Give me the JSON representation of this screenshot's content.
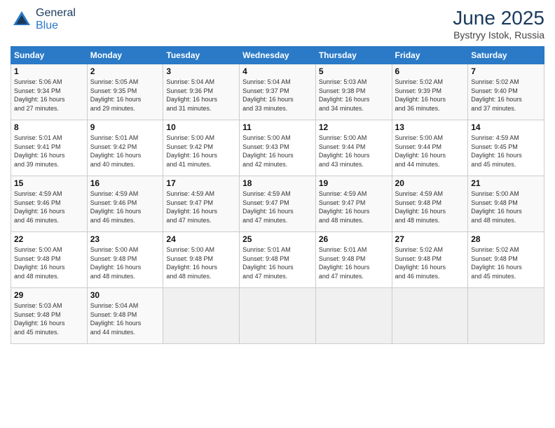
{
  "header": {
    "logo_general": "General",
    "logo_blue": "Blue",
    "title": "June 2025",
    "subtitle": "Bystryy Istok, Russia"
  },
  "days_of_week": [
    "Sunday",
    "Monday",
    "Tuesday",
    "Wednesday",
    "Thursday",
    "Friday",
    "Saturday"
  ],
  "weeks": [
    [
      {
        "day": "1",
        "sunrise": "5:06 AM",
        "sunset": "9:34 PM",
        "daylight": "16 hours and 27 minutes."
      },
      {
        "day": "2",
        "sunrise": "5:05 AM",
        "sunset": "9:35 PM",
        "daylight": "16 hours and 29 minutes."
      },
      {
        "day": "3",
        "sunrise": "5:04 AM",
        "sunset": "9:36 PM",
        "daylight": "16 hours and 31 minutes."
      },
      {
        "day": "4",
        "sunrise": "5:04 AM",
        "sunset": "9:37 PM",
        "daylight": "16 hours and 33 minutes."
      },
      {
        "day": "5",
        "sunrise": "5:03 AM",
        "sunset": "9:38 PM",
        "daylight": "16 hours and 34 minutes."
      },
      {
        "day": "6",
        "sunrise": "5:02 AM",
        "sunset": "9:39 PM",
        "daylight": "16 hours and 36 minutes."
      },
      {
        "day": "7",
        "sunrise": "5:02 AM",
        "sunset": "9:40 PM",
        "daylight": "16 hours and 37 minutes."
      }
    ],
    [
      {
        "day": "8",
        "sunrise": "5:01 AM",
        "sunset": "9:41 PM",
        "daylight": "16 hours and 39 minutes."
      },
      {
        "day": "9",
        "sunrise": "5:01 AM",
        "sunset": "9:42 PM",
        "daylight": "16 hours and 40 minutes."
      },
      {
        "day": "10",
        "sunrise": "5:00 AM",
        "sunset": "9:42 PM",
        "daylight": "16 hours and 41 minutes."
      },
      {
        "day": "11",
        "sunrise": "5:00 AM",
        "sunset": "9:43 PM",
        "daylight": "16 hours and 42 minutes."
      },
      {
        "day": "12",
        "sunrise": "5:00 AM",
        "sunset": "9:44 PM",
        "daylight": "16 hours and 43 minutes."
      },
      {
        "day": "13",
        "sunrise": "5:00 AM",
        "sunset": "9:44 PM",
        "daylight": "16 hours and 44 minutes."
      },
      {
        "day": "14",
        "sunrise": "4:59 AM",
        "sunset": "9:45 PM",
        "daylight": "16 hours and 45 minutes."
      }
    ],
    [
      {
        "day": "15",
        "sunrise": "4:59 AM",
        "sunset": "9:46 PM",
        "daylight": "16 hours and 46 minutes."
      },
      {
        "day": "16",
        "sunrise": "4:59 AM",
        "sunset": "9:46 PM",
        "daylight": "16 hours and 46 minutes."
      },
      {
        "day": "17",
        "sunrise": "4:59 AM",
        "sunset": "9:47 PM",
        "daylight": "16 hours and 47 minutes."
      },
      {
        "day": "18",
        "sunrise": "4:59 AM",
        "sunset": "9:47 PM",
        "daylight": "16 hours and 47 minutes."
      },
      {
        "day": "19",
        "sunrise": "4:59 AM",
        "sunset": "9:47 PM",
        "daylight": "16 hours and 48 minutes."
      },
      {
        "day": "20",
        "sunrise": "4:59 AM",
        "sunset": "9:48 PM",
        "daylight": "16 hours and 48 minutes."
      },
      {
        "day": "21",
        "sunrise": "5:00 AM",
        "sunset": "9:48 PM",
        "daylight": "16 hours and 48 minutes."
      }
    ],
    [
      {
        "day": "22",
        "sunrise": "5:00 AM",
        "sunset": "9:48 PM",
        "daylight": "16 hours and 48 minutes."
      },
      {
        "day": "23",
        "sunrise": "5:00 AM",
        "sunset": "9:48 PM",
        "daylight": "16 hours and 48 minutes."
      },
      {
        "day": "24",
        "sunrise": "5:00 AM",
        "sunset": "9:48 PM",
        "daylight": "16 hours and 48 minutes."
      },
      {
        "day": "25",
        "sunrise": "5:01 AM",
        "sunset": "9:48 PM",
        "daylight": "16 hours and 47 minutes."
      },
      {
        "day": "26",
        "sunrise": "5:01 AM",
        "sunset": "9:48 PM",
        "daylight": "16 hours and 47 minutes."
      },
      {
        "day": "27",
        "sunrise": "5:02 AM",
        "sunset": "9:48 PM",
        "daylight": "16 hours and 46 minutes."
      },
      {
        "day": "28",
        "sunrise": "5:02 AM",
        "sunset": "9:48 PM",
        "daylight": "16 hours and 45 minutes."
      }
    ],
    [
      {
        "day": "29",
        "sunrise": "5:03 AM",
        "sunset": "9:48 PM",
        "daylight": "16 hours and 45 minutes."
      },
      {
        "day": "30",
        "sunrise": "5:04 AM",
        "sunset": "9:48 PM",
        "daylight": "16 hours and 44 minutes."
      },
      null,
      null,
      null,
      null,
      null
    ]
  ]
}
